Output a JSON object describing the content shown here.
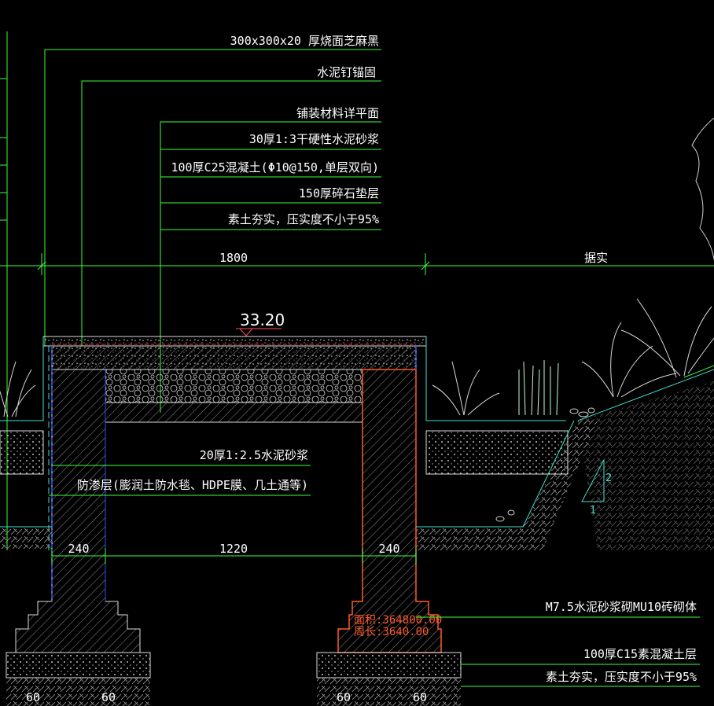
{
  "callouts_top": [
    "300x300x20 厚烧面芝麻黑",
    "水泥钉锚固",
    "铺装材料详平面",
    "30厚1:3干硬性水泥砂浆",
    "100厚C25混凝土(Φ10@150,单层双向)",
    "150厚碎石垫层",
    "素土夯实，压实度不小于95%"
  ],
  "callouts_mid": [
    "20厚1:2.5水泥砂浆",
    "防渗层(膨润土防水毯、HDPE膜、几土通等)"
  ],
  "callouts_right": [
    "M7.5水泥砂浆砌MU10砖砌体",
    "100厚C15素混凝土层",
    "素土夯实，压实度不小于95%"
  ],
  "dimensions": {
    "top_span": "1800",
    "right_label": "据实",
    "elevation": "33.20",
    "left_wall": "240",
    "inner_span": "1220",
    "right_wall": "240",
    "footing_left_a": "60",
    "footing_left_b": "60",
    "footing_right_a": "60",
    "footing_right_b": "60"
  },
  "red_tags": [
    "面积:364800.00",
    "周长:3640.00"
  ],
  "slope": {
    "rise": "2",
    "run": "1"
  },
  "colors": {
    "background": "#000000",
    "leader": "#3cff3c",
    "text": "#ffffff",
    "hatch": "#9a9a9a",
    "water": "#40e0d0",
    "blue": "#3050ff",
    "red": "#ff5a2a"
  }
}
